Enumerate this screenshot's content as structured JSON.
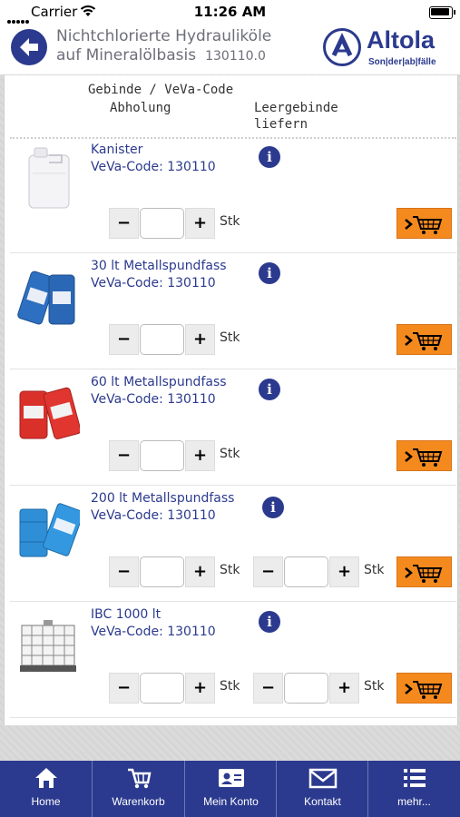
{
  "status_bar": {
    "carrier": "Carrier",
    "time": "11:26 AM"
  },
  "header": {
    "title_line1": "Nichtchlorierte Hydrauliköle",
    "title_line2": "auf Mineralölbasis",
    "code": "130110.0",
    "logo_name": "Altola",
    "logo_tagline": "Son|der|ab|fälle"
  },
  "columns": {
    "gebinde": "Gebinde / VeVa-Code",
    "abholung": "Abholung",
    "leergebinde_line1": "Leergebinde",
    "leergebinde_line2": "liefern"
  },
  "products": [
    {
      "name": "Kanister",
      "code": "VeVa-Code: 130110",
      "unit": "Stk",
      "pickup_qty": "",
      "has_empty": false,
      "image": "white-canister"
    },
    {
      "name": "30 lt Metallspundfass",
      "code": "VeVa-Code: 130110",
      "unit": "Stk",
      "pickup_qty": "",
      "has_empty": false,
      "image": "blue-drums"
    },
    {
      "name": "60 lt Metallspundfass",
      "code": "VeVa-Code: 130110",
      "unit": "Stk",
      "pickup_qty": "",
      "has_empty": false,
      "image": "red-drums"
    },
    {
      "name": "200 lt Metallspundfass",
      "code": "VeVa-Code: 130110",
      "unit": "Stk",
      "pickup_qty": "",
      "empty_qty": "",
      "empty_unit": "Stk",
      "has_empty": true,
      "image": "blue-barrels"
    },
    {
      "name": "IBC 1000 lt",
      "code": "VeVa-Code: 130110",
      "unit": "Stk",
      "pickup_qty": "",
      "empty_qty": "",
      "empty_unit": "Stk",
      "has_empty": true,
      "image": "ibc-tank"
    }
  ],
  "stepper": {
    "minus": "−",
    "plus": "+"
  },
  "info_glyph": "i",
  "tabs": [
    {
      "label": "Home",
      "icon": "home-icon"
    },
    {
      "label": "Warenkorb",
      "icon": "cart-icon"
    },
    {
      "label": "Mein Konto",
      "icon": "account-card-icon"
    },
    {
      "label": "Kontakt",
      "icon": "envelope-icon"
    },
    {
      "label": "mehr...",
      "icon": "list-icon"
    }
  ],
  "colors": {
    "brand_blue": "#2b3a8e",
    "cart_orange": "#f48a1e"
  }
}
